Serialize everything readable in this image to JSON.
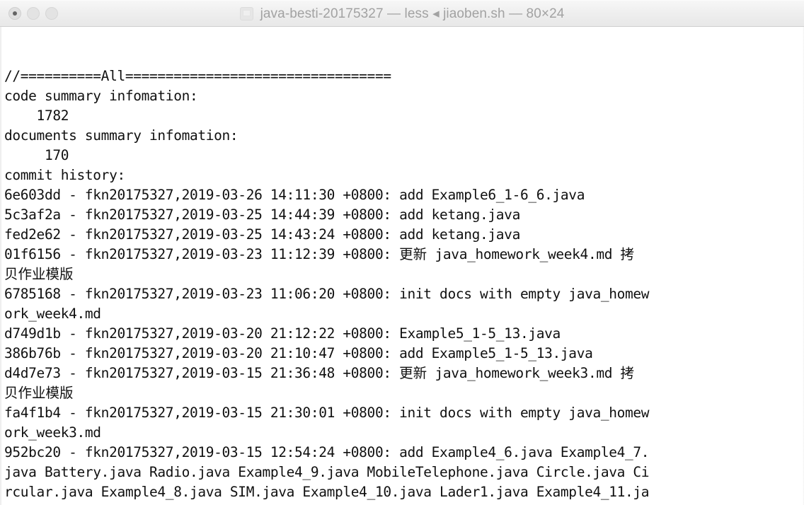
{
  "window": {
    "title": "java-besti-20175327 — less ◂ jiaoben.sh — 80×24",
    "title_icon": "terminal-document-icon",
    "size_spec": "80×24",
    "session_name": "java-besti-20175327",
    "program": "less",
    "script": "jiaoben.sh",
    "controls": {
      "close_label": "",
      "minimize_label": "",
      "maximize_label": ""
    },
    "colors": {
      "titlebar_bg": "#eeeeee",
      "titlebar_text": "#a2a2a2",
      "terminal_bg": "#ffffff",
      "terminal_text": "#101010"
    }
  },
  "terminal": {
    "cols": 80,
    "rows": 24,
    "lines": [
      "//==========All=================================",
      "code summary infomation:",
      "    1782",
      "documents summary infomation:",
      "     170",
      "commit history:",
      "6e603dd - fkn20175327,2019-03-26 14:11:30 +0800: add Example6_1-6_6.java",
      "5c3af2a - fkn20175327,2019-03-25 14:44:39 +0800: add ketang.java",
      "fed2e62 - fkn20175327,2019-03-25 14:43:24 +0800: add ketang.java",
      "01f6156 - fkn20175327,2019-03-23 11:12:39 +0800: 更新 java_homework_week4.md 拷",
      "贝作业模版",
      "6785168 - fkn20175327,2019-03-23 11:06:20 +0800: init docs with empty java_homew",
      "ork_week4.md",
      "d749d1b - fkn20175327,2019-03-20 21:12:22 +0800: Example5_1-5_13.java",
      "386b76b - fkn20175327,2019-03-20 21:10:47 +0800: add Example5_1-5_13.java",
      "d4d7e73 - fkn20175327,2019-03-15 21:36:48 +0800: 更新 java_homework_week3.md 拷",
      "贝作业模版",
      "fa4f1b4 - fkn20175327,2019-03-15 21:30:01 +0800: init docs with empty java_homew",
      "ork_week3.md",
      "952bc20 - fkn20175327,2019-03-15 12:54:24 +0800: add Example4_6.java Example4_7.",
      "java Battery.java Radio.java Example4_9.java MobileTelephone.java Circle.java Ci",
      "rcular.java Example4_8.java SIM.java Example4_10.java Lader1.java Example4_11.ja"
    ],
    "summary": {
      "header": "//==========All=================================",
      "code_summary_label": "code summary infomation:",
      "code_summary_value": "1782",
      "documents_summary_label": "documents summary infomation:",
      "documents_summary_value": "170",
      "commit_history_label": "commit history:"
    },
    "commits": [
      {
        "hash": "6e603dd",
        "author": "fkn20175327",
        "date": "2019-03-26",
        "time": "14:11:30",
        "tz": "+0800",
        "message": "add Example6_1-6_6.java"
      },
      {
        "hash": "5c3af2a",
        "author": "fkn20175327",
        "date": "2019-03-25",
        "time": "14:44:39",
        "tz": "+0800",
        "message": "add ketang.java"
      },
      {
        "hash": "fed2e62",
        "author": "fkn20175327",
        "date": "2019-03-25",
        "time": "14:43:24",
        "tz": "+0800",
        "message": "add ketang.java"
      },
      {
        "hash": "01f6156",
        "author": "fkn20175327",
        "date": "2019-03-23",
        "time": "11:12:39",
        "tz": "+0800",
        "message": "更新 java_homework_week4.md 拷贝作业模版"
      },
      {
        "hash": "6785168",
        "author": "fkn20175327",
        "date": "2019-03-23",
        "time": "11:06:20",
        "tz": "+0800",
        "message": "init docs with empty java_homework_week4.md"
      },
      {
        "hash": "d749d1b",
        "author": "fkn20175327",
        "date": "2019-03-20",
        "time": "21:12:22",
        "tz": "+0800",
        "message": "Example5_1-5_13.java"
      },
      {
        "hash": "386b76b",
        "author": "fkn20175327",
        "date": "2019-03-20",
        "time": "21:10:47",
        "tz": "+0800",
        "message": "add Example5_1-5_13.java"
      },
      {
        "hash": "d4d7e73",
        "author": "fkn20175327",
        "date": "2019-03-15",
        "time": "21:36:48",
        "tz": "+0800",
        "message": "更新 java_homework_week3.md 拷贝作业模版"
      },
      {
        "hash": "fa4f1b4",
        "author": "fkn20175327",
        "date": "2019-03-15",
        "time": "21:30:01",
        "tz": "+0800",
        "message": "init docs with empty java_homework_week3.md"
      },
      {
        "hash": "952bc20",
        "author": "fkn20175327",
        "date": "2019-03-15",
        "time": "12:54:24",
        "tz": "+0800",
        "message": "add Example4_6.java Example4_7.java Battery.java Radio.java Example4_9.java MobileTelephone.java Circle.java Circular.java Example4_8.java SIM.java Example4_10.java Lader1.java Example4_11.ja"
      }
    ]
  }
}
